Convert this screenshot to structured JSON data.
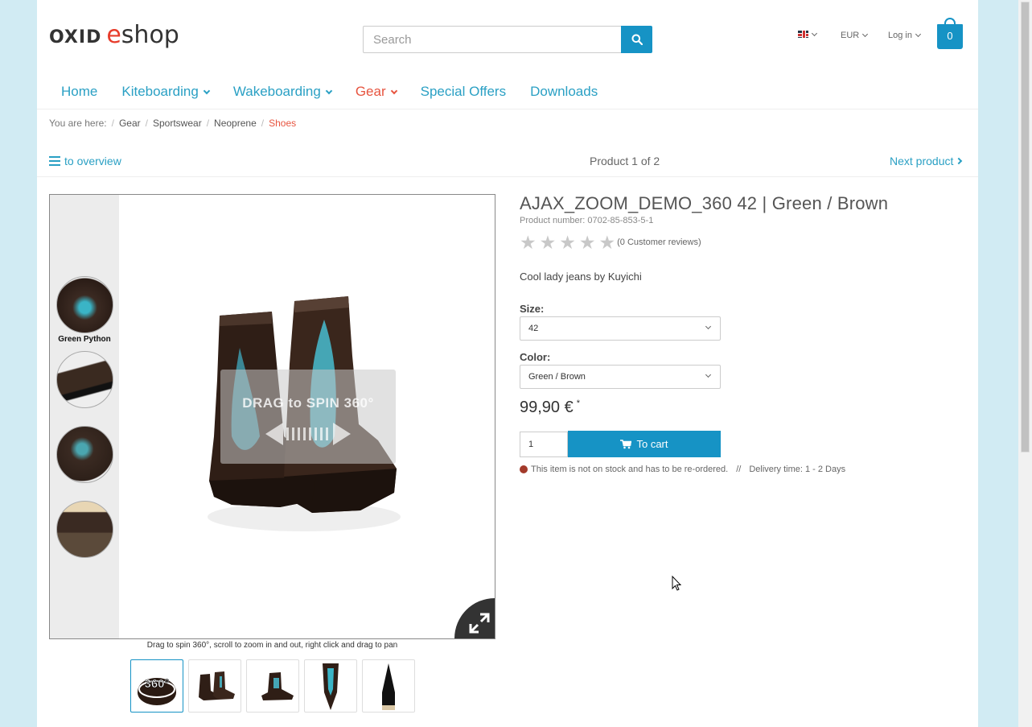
{
  "header": {
    "logo_part1": "OXID",
    "logo_part2_e": "e",
    "logo_part2_rest": "shop",
    "search_placeholder": "Search",
    "currency": "EUR",
    "login": "Log in",
    "basket_count": "0"
  },
  "nav": {
    "items": [
      {
        "label": "Home",
        "dropdown": false
      },
      {
        "label": "Kiteboarding",
        "dropdown": true
      },
      {
        "label": "Wakeboarding",
        "dropdown": true
      },
      {
        "label": "Gear",
        "dropdown": true,
        "active": true
      },
      {
        "label": "Special Offers",
        "dropdown": false
      },
      {
        "label": "Downloads",
        "dropdown": false
      }
    ]
  },
  "breadcrumb": {
    "prefix": "You are here:",
    "items": [
      "Gear",
      "Sportswear",
      "Neoprene"
    ],
    "current": "Shoes"
  },
  "pager": {
    "overview": "to overview",
    "count": "Product 1 of 2",
    "next": "Next product"
  },
  "viewer": {
    "thumb_label": "Green Python",
    "overlay_text": "DRAG to SPIN 360°",
    "caption": "Drag to spin 360°, scroll to zoom in and out, right click and drag to pan",
    "thumb_360_text": "360°"
  },
  "product": {
    "title": "AJAX_ZOOM_DEMO_360 42 | Green / Brown",
    "number": "Product number: 0702-85-853-5-1",
    "rating_stars": 0,
    "reviews": "(0 Customer reviews)",
    "short_description": "Cool lady jeans by Kuyichi",
    "size_label": "Size:",
    "size_value": "42",
    "color_label": "Color:",
    "color_value": "Green / Brown",
    "price": "99,90 €",
    "price_mark": "*",
    "quantity": "1",
    "cart_button": "To cart",
    "stock_text": "This item is not on stock and has to be re-ordered.",
    "stock_sep": "//",
    "delivery": "Delivery time: 1 - 2 Days"
  },
  "colors": {
    "accent": "#1693c5",
    "link": "#2aa0c4",
    "active": "#e7543f",
    "background": "#d1ebf3"
  }
}
